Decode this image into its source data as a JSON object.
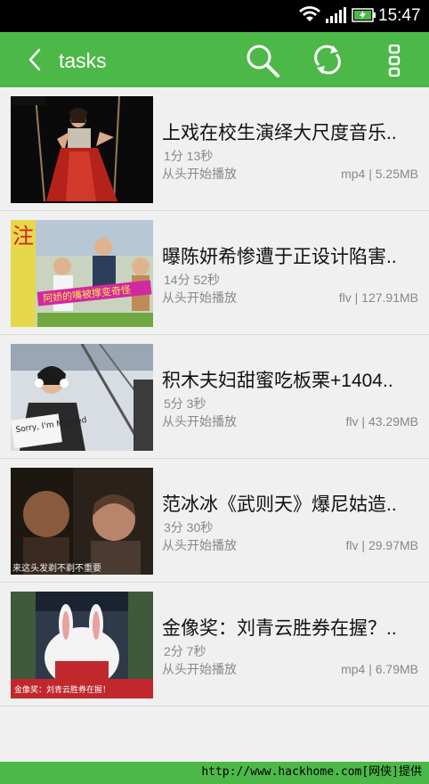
{
  "status_bar": {
    "time": "15:47"
  },
  "app_bar": {
    "title": "tasks",
    "back_icon": "chevron-left-icon",
    "search_icon": "search-icon",
    "refresh_icon": "refresh-icon",
    "more_icon": "more-vertical-icon"
  },
  "tasks": [
    {
      "title": "上戏在校生演绎大尺度音乐..",
      "duration": "1分 13秒",
      "action": "从头开始播放",
      "meta": "mp4 | 5.25MB"
    },
    {
      "title": "曝陈妍希惨遭于正设计陷害..",
      "duration": "14分 52秒",
      "action": "从头开始播放",
      "meta": "flv | 127.91MB"
    },
    {
      "title": "积木夫妇甜蜜吃板栗+1404..",
      "duration": "5分 3秒",
      "action": "从头开始播放",
      "meta": "flv | 43.29MB"
    },
    {
      "title": "范冰冰《武则天》爆尼姑造..",
      "duration": "3分 30秒",
      "action": "从头开始播放",
      "meta": "flv | 29.97MB"
    },
    {
      "title": "金像奖：刘青云胜券在握？..",
      "duration": "2分 7秒",
      "action": "从头开始播放",
      "meta": "mp4 | 6.79MB"
    }
  ],
  "thumb_text": {
    "t2_badge": "注",
    "t2_caption": "阿娇的嘴被撑变奇怪",
    "t3_sign": "Sorry, I'm Married",
    "t4_subtitle": "来这头发剃不剃不重要",
    "t5_ticker": "金像奖：刘青云胜券在握！"
  },
  "watermark": "http://www.hackhome.com[网侠]提供"
}
